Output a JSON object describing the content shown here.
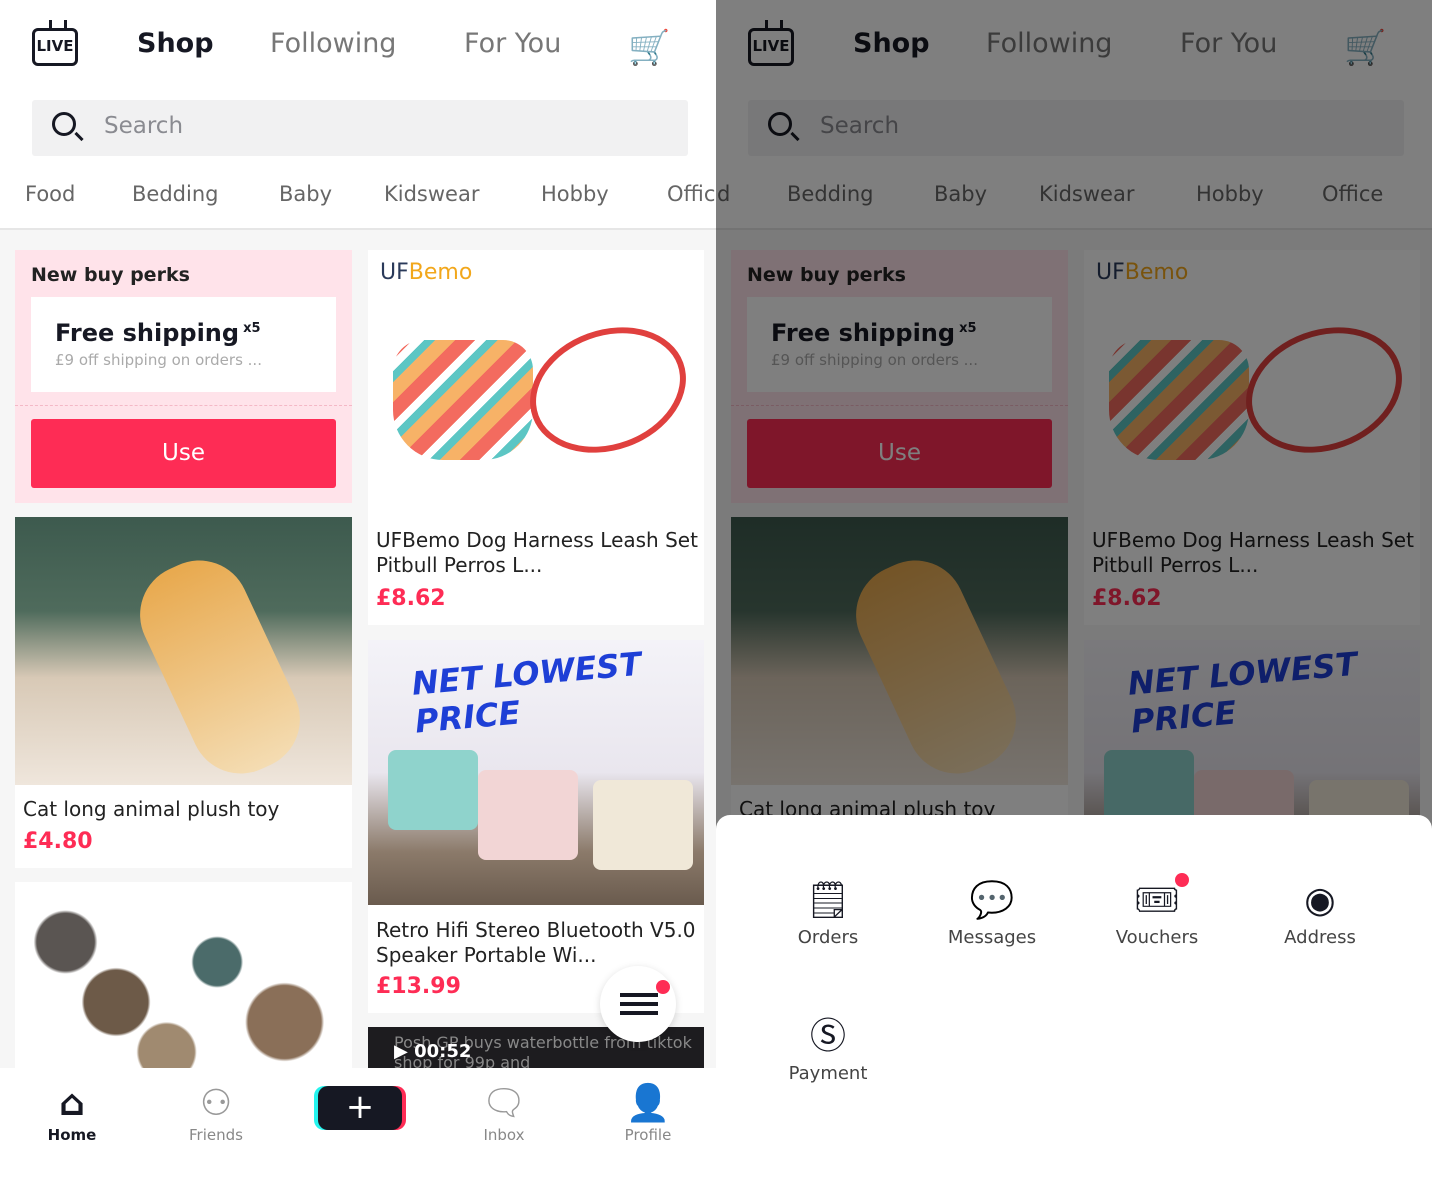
{
  "header": {
    "live_icon": "live-tv-icon",
    "tabs": [
      "Shop",
      "Following",
      "For You"
    ],
    "active_tab": "Shop",
    "cart_icon": "cart-icon"
  },
  "search": {
    "placeholder": "Search"
  },
  "categories": [
    "Food",
    "Bedding",
    "Baby",
    "Kidswear",
    "Hobby",
    "Office"
  ],
  "perks": {
    "title": "New buy perks",
    "coupon_title": "Free shipping",
    "coupon_count": "x5",
    "coupon_sub": "£9 off shipping on orders ...",
    "use_label": "Use"
  },
  "products": [
    {
      "brand": "UFBemo",
      "title": "UFBemo Dog Harness Leash Set Pitbull Perros L...",
      "price": "£8.62"
    },
    {
      "title": "Cat long animal plush toy",
      "price": "£4.80"
    },
    {
      "banner": "NET LOWEST PRICE",
      "title": "Retro Hifi Stereo Bluetooth V5.0 Speaker Portable Wi...",
      "price": "£13.99"
    },
    {
      "video_duration": "00:52",
      "video_caption": "Posh GP buys waterbottle from tiktok shop for 99p and"
    }
  ],
  "nav": [
    {
      "label": "Home",
      "icon": "home-icon"
    },
    {
      "label": "Friends",
      "icon": "friends-icon"
    },
    {
      "label": "",
      "icon": "plus-icon"
    },
    {
      "label": "Inbox",
      "icon": "inbox-icon"
    },
    {
      "label": "Profile",
      "icon": "profile-icon"
    }
  ],
  "menu_sheet": {
    "items": [
      {
        "label": "Orders",
        "icon": "orders-icon"
      },
      {
        "label": "Messages",
        "icon": "messages-icon"
      },
      {
        "label": "Vouchers",
        "icon": "vouchers-icon",
        "badge": true
      },
      {
        "label": "Address",
        "icon": "address-icon"
      },
      {
        "label": "Payment",
        "icon": "payment-icon"
      }
    ]
  },
  "colors": {
    "accent": "#fe2c55",
    "perks_bg": "#ffe3ea"
  }
}
